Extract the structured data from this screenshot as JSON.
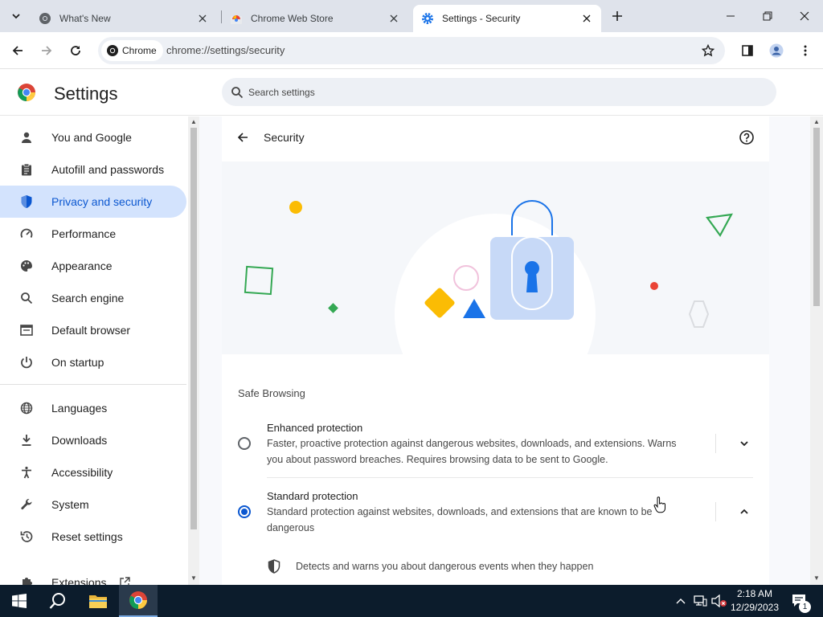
{
  "browser": {
    "tabs": [
      {
        "title": "What's New",
        "active": false
      },
      {
        "title": "Chrome Web Store",
        "active": false
      },
      {
        "title": "Settings - Security",
        "active": true
      }
    ],
    "site_chip": "Chrome",
    "url": "chrome://settings/security"
  },
  "settings": {
    "title": "Settings",
    "search_placeholder": "Search settings"
  },
  "sidebar": {
    "items": [
      {
        "label": "You and Google",
        "icon": "person-icon"
      },
      {
        "label": "Autofill and passwords",
        "icon": "clipboard-icon"
      },
      {
        "label": "Privacy and security",
        "icon": "shield-icon",
        "selected": true
      },
      {
        "label": "Performance",
        "icon": "speedometer-icon"
      },
      {
        "label": "Appearance",
        "icon": "palette-icon"
      },
      {
        "label": "Search engine",
        "icon": "search-icon"
      },
      {
        "label": "Default browser",
        "icon": "browser-window-icon"
      },
      {
        "label": "On startup",
        "icon": "power-icon"
      },
      {
        "label": "Languages",
        "icon": "globe-icon"
      },
      {
        "label": "Downloads",
        "icon": "download-icon"
      },
      {
        "label": "Accessibility",
        "icon": "accessibility-icon"
      },
      {
        "label": "System",
        "icon": "wrench-icon"
      },
      {
        "label": "Reset settings",
        "icon": "history-icon"
      },
      {
        "label": "Extensions",
        "icon": "puzzle-icon"
      }
    ]
  },
  "page": {
    "title": "Security",
    "section_title": "Safe Browsing",
    "options": [
      {
        "title": "Enhanced protection",
        "desc_line1": "Faster, proactive protection against dangerous websites, downloads, and extensions. Warns",
        "desc_line2": "you about password breaches. Requires browsing data to be sent to Google.",
        "checked": false,
        "expanded": false
      },
      {
        "title": "Standard protection",
        "desc_line1": "Standard protection against websites, downloads, and extensions that are known to be",
        "desc_line2": "dangerous",
        "checked": true,
        "expanded": true
      }
    ],
    "detail_item": "Detects and warns you about dangerous events when they happen"
  },
  "taskbar": {
    "time": "2:18 AM",
    "date": "12/29/2023",
    "notification_count": "1"
  },
  "colors": {
    "accent": "#0b57d0",
    "selected_bg": "#d3e3fd",
    "taskbar": "#0c1c2c"
  }
}
